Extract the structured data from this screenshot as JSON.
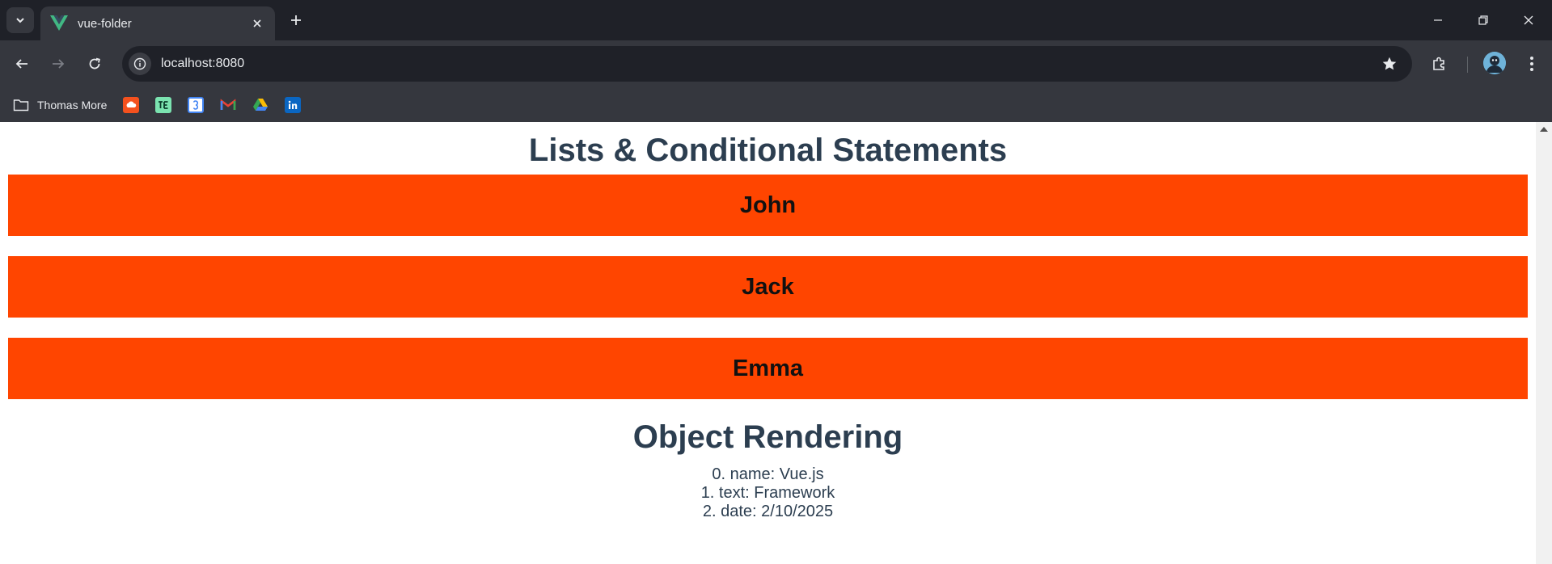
{
  "browser": {
    "tab": {
      "title": "vue-folder"
    },
    "address": {
      "url": "localhost:8080"
    },
    "bookmarks": {
      "folder_label": "Thomas More",
      "items": [
        {
          "icon": "cloud-icon",
          "color": "#f4511e"
        },
        {
          "icon": "te-icon",
          "color": "#7be3b0"
        },
        {
          "icon": "calendar-icon",
          "color": "#4285f4"
        },
        {
          "icon": "gmail-icon",
          "color": "#ea4335"
        },
        {
          "icon": "drive-icon",
          "color": "#fbbc04"
        },
        {
          "icon": "linkedin-icon",
          "color": "#0a66c2"
        }
      ]
    },
    "colors": {
      "frame": "#1f2128",
      "toolbar": "#35373e",
      "text": "#e8eaed"
    }
  },
  "page": {
    "title": "Lists & Conditional Statements",
    "people": [
      "John",
      "Jack",
      "Emma"
    ],
    "object_title": "Object Rendering",
    "object_entries": [
      "0. name: Vue.js",
      "1. text: Framework",
      "2. date: 2/10/2025"
    ],
    "colors": {
      "box": "#ff4500",
      "heading": "#2c3e50"
    }
  }
}
